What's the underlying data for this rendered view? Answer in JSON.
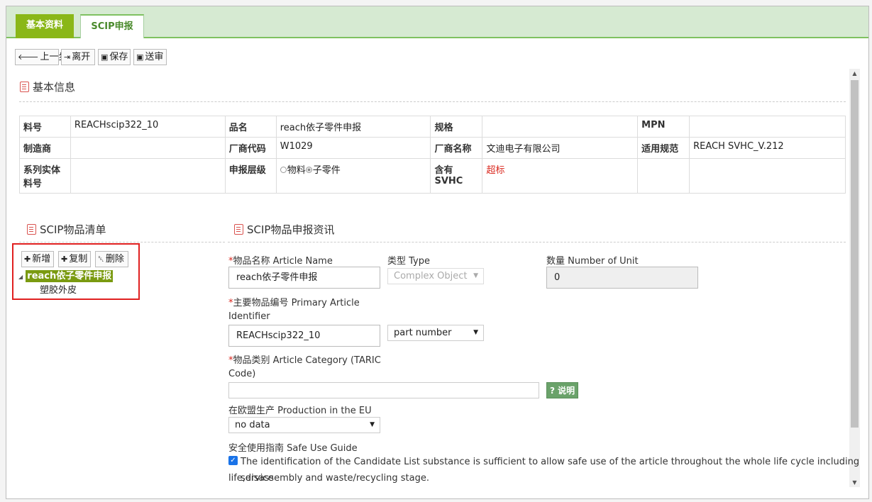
{
  "tabs": [
    {
      "label": "基本资料"
    },
    {
      "label": "SCIP申报"
    }
  ],
  "toolbar": {
    "prev_label": "上一步",
    "leave_label": "离开",
    "save_label": "保存",
    "submit_label": "送审"
  },
  "basic": {
    "title": "基本信息",
    "rows": [
      [
        "料号",
        "REACHscip322_10",
        "品名",
        "reach依子零件申报",
        "规格",
        "",
        "MPN",
        ""
      ],
      [
        "制造商",
        "",
        "厂商代码",
        "W1029",
        "厂商名称",
        "文迪电子有限公司",
        "适用规范",
        "REACH SVHC_V.212"
      ]
    ],
    "row3": {
      "l1": "系列实体料号",
      "v1": "",
      "l2": "申报层级",
      "opt1": "物料",
      "opt2": "子零件",
      "l3": "含有SVHC",
      "v3": "超标"
    }
  },
  "list": {
    "title": "SCIP物品清单",
    "add_label": "新增",
    "copy_label": "复制",
    "delete_label": "删除",
    "node_root": "reach依子零件申报",
    "node_child": "塑胶外皮"
  },
  "detail": {
    "title": "SCIP物品申报资讯",
    "article_name_label": "物品名称 Article Name",
    "article_name_value": "reach依子零件申报",
    "type_label": "类型 Type",
    "type_value": "Complex Object",
    "units_label": "数量 Number of Unit",
    "units_value": "0",
    "primary_label_1": "主要物品编号 Primary Article",
    "primary_label_2": "Identifier",
    "primary_value": "REACHscip322_10",
    "primary_type": "part number",
    "category_label_1": "物品类别 Article Category (TARIC",
    "category_label_2": "Code)",
    "category_value": "",
    "help_label": "说明",
    "eu_label": "在欧盟生产 Production in the EU",
    "eu_value": "no data",
    "guide_label": "安全使用指南 Safe Use Guide",
    "guide_text_1": "The identification of the Candidate List substance is sufficient to allow safe use of the article throughout the whole life cycle including service",
    "guide_text_2": "life,disassembly and waste/recycling stage."
  }
}
